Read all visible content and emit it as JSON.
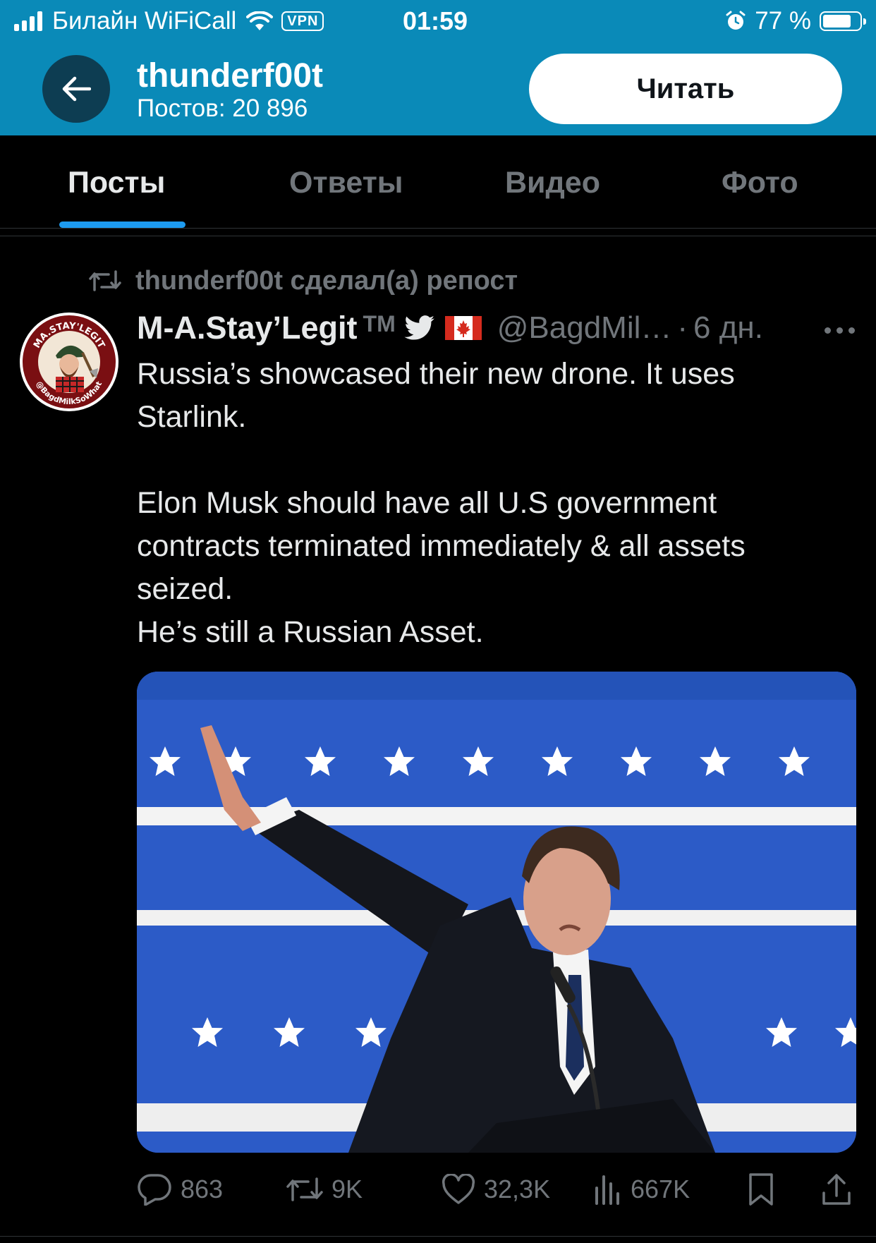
{
  "status_bar": {
    "carrier": "Билайн WiFiCall",
    "vpn": "VPN",
    "time": "01:59",
    "battery_percent": "77 %",
    "battery_level": 0.77
  },
  "header": {
    "back_icon": "arrow-left-icon",
    "profile_name": "thunderf00t",
    "post_count": "Постов: 20 896",
    "follow_label": "Читать"
  },
  "tabs": [
    {
      "label": "Посты",
      "active": true
    },
    {
      "label": "Ответы",
      "active": false
    },
    {
      "label": "Видео",
      "active": false
    },
    {
      "label": "Фото",
      "active": false
    }
  ],
  "tweet": {
    "repost_text": "thunderf00t сделал(а) репост",
    "author": "M-A.Stay’Legit",
    "trademark": "TM",
    "handle": "@BagdMil…",
    "separator": "·",
    "time": "6 дн.",
    "avatar_text_top": "MA.STAY'LEGIT",
    "avatar_text_bottom": "@BagdMilkSoWhat",
    "text": [
      "Russia’s showcased their new drone.  It uses Starlink.",
      "",
      "Elon Musk should have all U.S government contracts terminated immediately & all assets seized.",
      "He’s still a Russian Asset."
    ],
    "stats": {
      "replies": "863",
      "reposts": "9K",
      "likes": "32,3K",
      "views": "667K"
    }
  },
  "colors": {
    "header_bg": "#0a8ab8",
    "accent": "#1d9bf0",
    "muted": "#71767b",
    "text": "#e7e9ea",
    "background": "#000000"
  }
}
